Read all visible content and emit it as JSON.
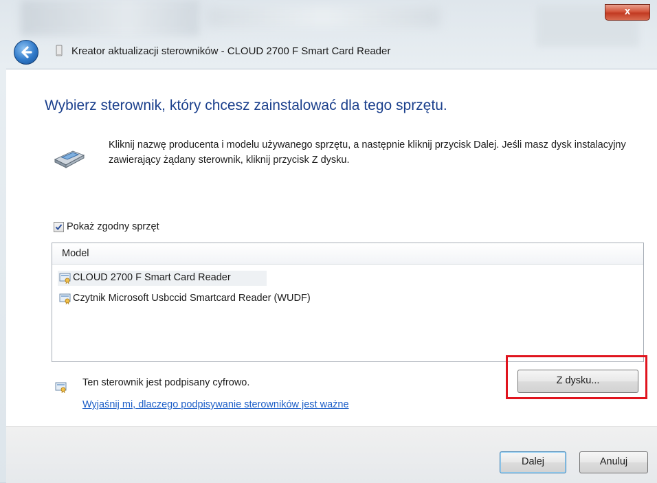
{
  "window": {
    "title": "Kreator aktualizacji sterowników - CLOUD 2700 F Smart Card Reader",
    "close_label": "x",
    "accent": "#1a3f8c",
    "link_color": "#1c5ec7",
    "highlight_color": "#e0141e"
  },
  "page": {
    "heading": "Wybierz sterownik, który chcesz zainstalować dla tego sprzętu.",
    "description": "Kliknij nazwę producenta i modelu używanego sprzętu, a następnie kliknij przycisk Dalej. Jeśli masz dysk instalacyjny zawierający żądany sterownik, kliknij przycisk Z dysku.",
    "hardware_icon": "smart-card-reader-icon"
  },
  "compatible": {
    "label": "Pokaż zgodny sprzęt",
    "checked": true
  },
  "model_list": {
    "header": "Model",
    "items": [
      {
        "label": "CLOUD 2700 F Smart Card Reader",
        "selected": true,
        "icon": "certificate-driver-icon"
      },
      {
        "label": "Czytnik Microsoft Usbccid Smartcard Reader (WUDF)",
        "selected": false,
        "icon": "certificate-driver-icon"
      }
    ]
  },
  "signature": {
    "text": "Ten sterownik jest podpisany cyfrowo.",
    "link": "Wyjaśnij mi, dlaczego podpisywanie sterowników jest ważne",
    "icon": "certificate-icon"
  },
  "buttons": {
    "have_disk": "Z dysku...",
    "next": "Dalej",
    "cancel": "Anuluj"
  }
}
